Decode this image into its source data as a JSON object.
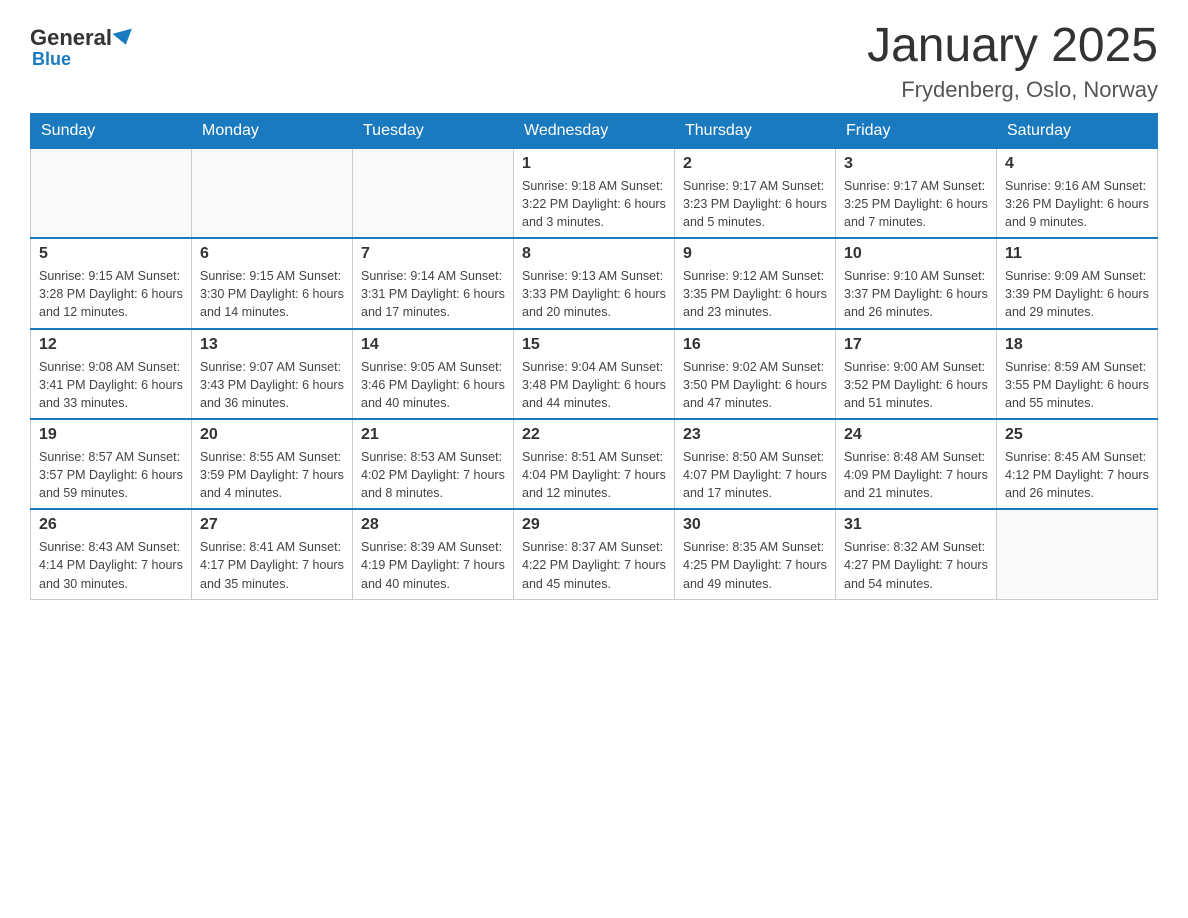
{
  "logo": {
    "general": "General",
    "blue": "Blue"
  },
  "header": {
    "title": "January 2025",
    "subtitle": "Frydenberg, Oslo, Norway"
  },
  "days": [
    "Sunday",
    "Monday",
    "Tuesday",
    "Wednesday",
    "Thursday",
    "Friday",
    "Saturday"
  ],
  "weeks": [
    [
      {
        "day": "",
        "info": ""
      },
      {
        "day": "",
        "info": ""
      },
      {
        "day": "",
        "info": ""
      },
      {
        "day": "1",
        "info": "Sunrise: 9:18 AM\nSunset: 3:22 PM\nDaylight: 6 hours\nand 3 minutes."
      },
      {
        "day": "2",
        "info": "Sunrise: 9:17 AM\nSunset: 3:23 PM\nDaylight: 6 hours\nand 5 minutes."
      },
      {
        "day": "3",
        "info": "Sunrise: 9:17 AM\nSunset: 3:25 PM\nDaylight: 6 hours\nand 7 minutes."
      },
      {
        "day": "4",
        "info": "Sunrise: 9:16 AM\nSunset: 3:26 PM\nDaylight: 6 hours\nand 9 minutes."
      }
    ],
    [
      {
        "day": "5",
        "info": "Sunrise: 9:15 AM\nSunset: 3:28 PM\nDaylight: 6 hours\nand 12 minutes."
      },
      {
        "day": "6",
        "info": "Sunrise: 9:15 AM\nSunset: 3:30 PM\nDaylight: 6 hours\nand 14 minutes."
      },
      {
        "day": "7",
        "info": "Sunrise: 9:14 AM\nSunset: 3:31 PM\nDaylight: 6 hours\nand 17 minutes."
      },
      {
        "day": "8",
        "info": "Sunrise: 9:13 AM\nSunset: 3:33 PM\nDaylight: 6 hours\nand 20 minutes."
      },
      {
        "day": "9",
        "info": "Sunrise: 9:12 AM\nSunset: 3:35 PM\nDaylight: 6 hours\nand 23 minutes."
      },
      {
        "day": "10",
        "info": "Sunrise: 9:10 AM\nSunset: 3:37 PM\nDaylight: 6 hours\nand 26 minutes."
      },
      {
        "day": "11",
        "info": "Sunrise: 9:09 AM\nSunset: 3:39 PM\nDaylight: 6 hours\nand 29 minutes."
      }
    ],
    [
      {
        "day": "12",
        "info": "Sunrise: 9:08 AM\nSunset: 3:41 PM\nDaylight: 6 hours\nand 33 minutes."
      },
      {
        "day": "13",
        "info": "Sunrise: 9:07 AM\nSunset: 3:43 PM\nDaylight: 6 hours\nand 36 minutes."
      },
      {
        "day": "14",
        "info": "Sunrise: 9:05 AM\nSunset: 3:46 PM\nDaylight: 6 hours\nand 40 minutes."
      },
      {
        "day": "15",
        "info": "Sunrise: 9:04 AM\nSunset: 3:48 PM\nDaylight: 6 hours\nand 44 minutes."
      },
      {
        "day": "16",
        "info": "Sunrise: 9:02 AM\nSunset: 3:50 PM\nDaylight: 6 hours\nand 47 minutes."
      },
      {
        "day": "17",
        "info": "Sunrise: 9:00 AM\nSunset: 3:52 PM\nDaylight: 6 hours\nand 51 minutes."
      },
      {
        "day": "18",
        "info": "Sunrise: 8:59 AM\nSunset: 3:55 PM\nDaylight: 6 hours\nand 55 minutes."
      }
    ],
    [
      {
        "day": "19",
        "info": "Sunrise: 8:57 AM\nSunset: 3:57 PM\nDaylight: 6 hours\nand 59 minutes."
      },
      {
        "day": "20",
        "info": "Sunrise: 8:55 AM\nSunset: 3:59 PM\nDaylight: 7 hours\nand 4 minutes."
      },
      {
        "day": "21",
        "info": "Sunrise: 8:53 AM\nSunset: 4:02 PM\nDaylight: 7 hours\nand 8 minutes."
      },
      {
        "day": "22",
        "info": "Sunrise: 8:51 AM\nSunset: 4:04 PM\nDaylight: 7 hours\nand 12 minutes."
      },
      {
        "day": "23",
        "info": "Sunrise: 8:50 AM\nSunset: 4:07 PM\nDaylight: 7 hours\nand 17 minutes."
      },
      {
        "day": "24",
        "info": "Sunrise: 8:48 AM\nSunset: 4:09 PM\nDaylight: 7 hours\nand 21 minutes."
      },
      {
        "day": "25",
        "info": "Sunrise: 8:45 AM\nSunset: 4:12 PM\nDaylight: 7 hours\nand 26 minutes."
      }
    ],
    [
      {
        "day": "26",
        "info": "Sunrise: 8:43 AM\nSunset: 4:14 PM\nDaylight: 7 hours\nand 30 minutes."
      },
      {
        "day": "27",
        "info": "Sunrise: 8:41 AM\nSunset: 4:17 PM\nDaylight: 7 hours\nand 35 minutes."
      },
      {
        "day": "28",
        "info": "Sunrise: 8:39 AM\nSunset: 4:19 PM\nDaylight: 7 hours\nand 40 minutes."
      },
      {
        "day": "29",
        "info": "Sunrise: 8:37 AM\nSunset: 4:22 PM\nDaylight: 7 hours\nand 45 minutes."
      },
      {
        "day": "30",
        "info": "Sunrise: 8:35 AM\nSunset: 4:25 PM\nDaylight: 7 hours\nand 49 minutes."
      },
      {
        "day": "31",
        "info": "Sunrise: 8:32 AM\nSunset: 4:27 PM\nDaylight: 7 hours\nand 54 minutes."
      },
      {
        "day": "",
        "info": ""
      }
    ]
  ]
}
